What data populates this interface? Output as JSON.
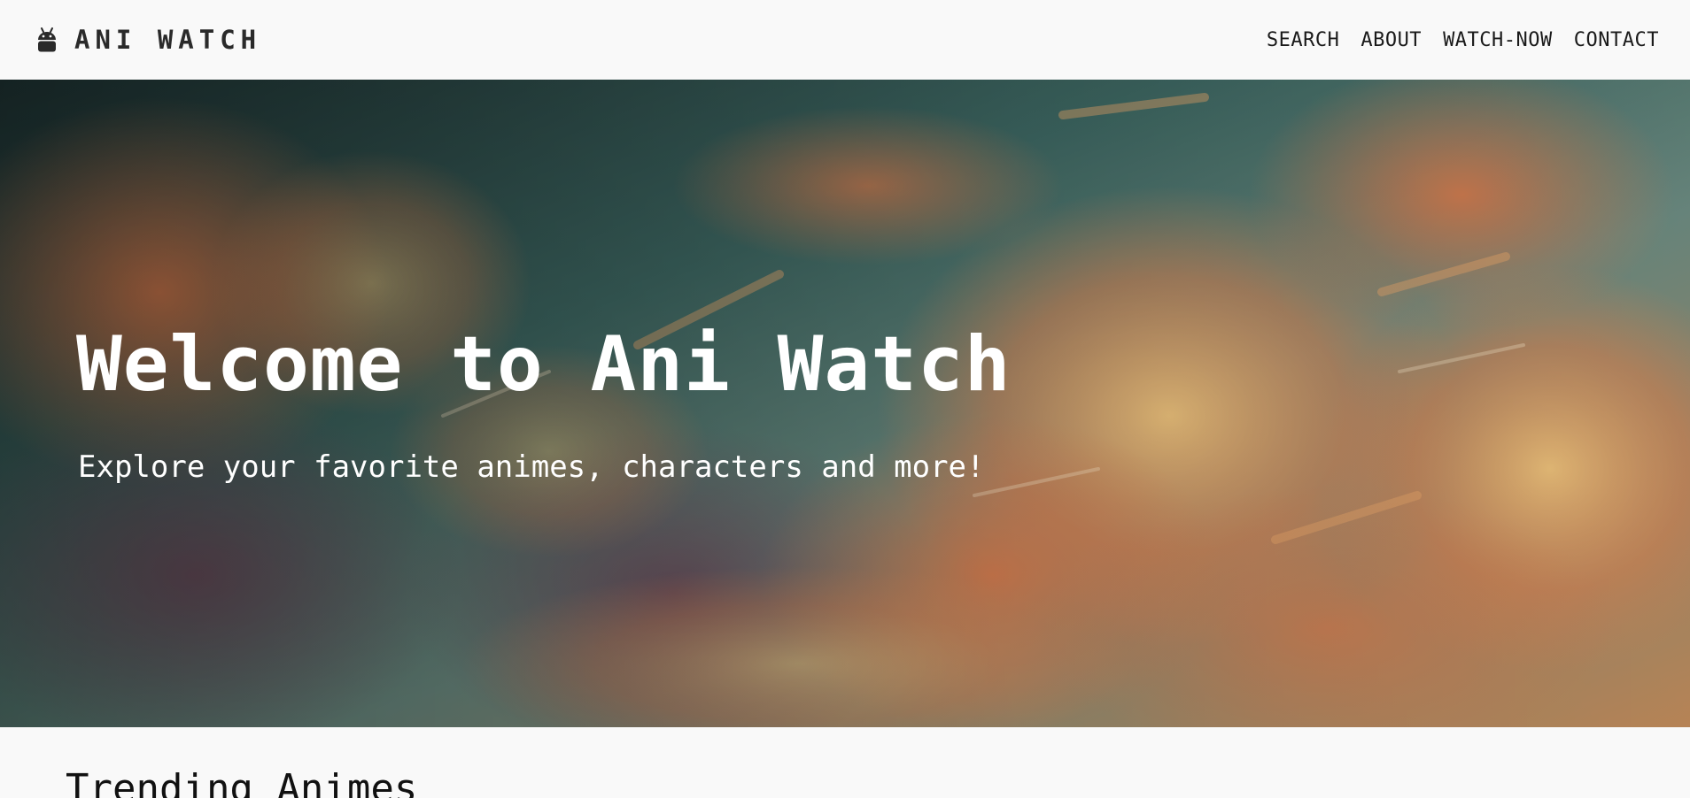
{
  "brand": {
    "icon": "android-icon",
    "name": "ANI WATCH"
  },
  "nav": {
    "items": [
      {
        "label": "SEARCH"
      },
      {
        "label": "ABOUT"
      },
      {
        "label": "WATCH-NOW"
      },
      {
        "label": "CONTACT"
      }
    ]
  },
  "hero": {
    "title": "Welcome to Ani Watch",
    "subtitle": "Explore your favorite animes, characters and more!",
    "background": "painted-cloud-sky-image"
  },
  "trending": {
    "title": "Trending Animes"
  },
  "colors": {
    "page_background": "#f9f9f9",
    "nav_text": "#1a1a1a",
    "hero_text": "#ffffff"
  }
}
